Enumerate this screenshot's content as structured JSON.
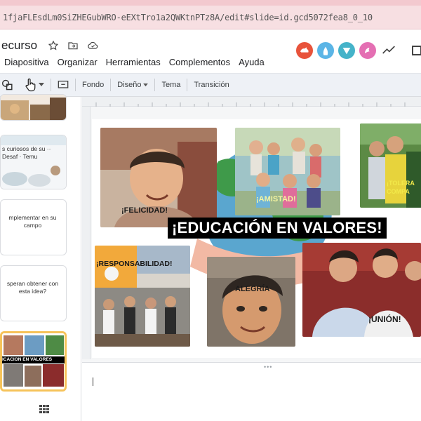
{
  "browser": {
    "url": "1fjaFLEsdLm0SiZHEGubWRO-eEXtTro1a2QWKtnPTz8A/edit#slide=id.gcd5072fea8_0_10"
  },
  "document": {
    "title": "ecurso"
  },
  "menu": {
    "items": [
      "Diapositiva",
      "Organizar",
      "Herramientas",
      "Complementos",
      "Ayuda"
    ]
  },
  "toolbar": {
    "fondo": "Fondo",
    "diseno": "Diseño",
    "tema": "Tema",
    "transicion": "Transición"
  },
  "thumbnails": [
    {
      "text": ""
    },
    {
      "text": "s curiosos de su ·· Desaf · Temu"
    },
    {
      "text": "mplementar en su campo"
    },
    {
      "text": "speran obtener con esta idea?"
    },
    {
      "text": "ICACIÓN EN VALORES"
    }
  ],
  "slide": {
    "banner": "¡EDUCACIÓN EN VALORES!",
    "labels": {
      "felicidad": "¡FELICIDAD!",
      "amistad": "¡AMISTAD!",
      "tolerancia_1": "¡TOLERA",
      "tolerancia_2": "COMPA",
      "responsabilidad": "¡RESPONSABILIDAD!",
      "alegria": "ALEGRÍA",
      "union": "¡UNIÓN!"
    }
  },
  "colors": {
    "accent": "#1a73e8",
    "avatar1": "#e8533b",
    "avatar2": "#5bb5e6",
    "avatar3": "#45b3c9",
    "avatar4": "#e46fb3",
    "thumb_selected": "#f6c35a"
  }
}
